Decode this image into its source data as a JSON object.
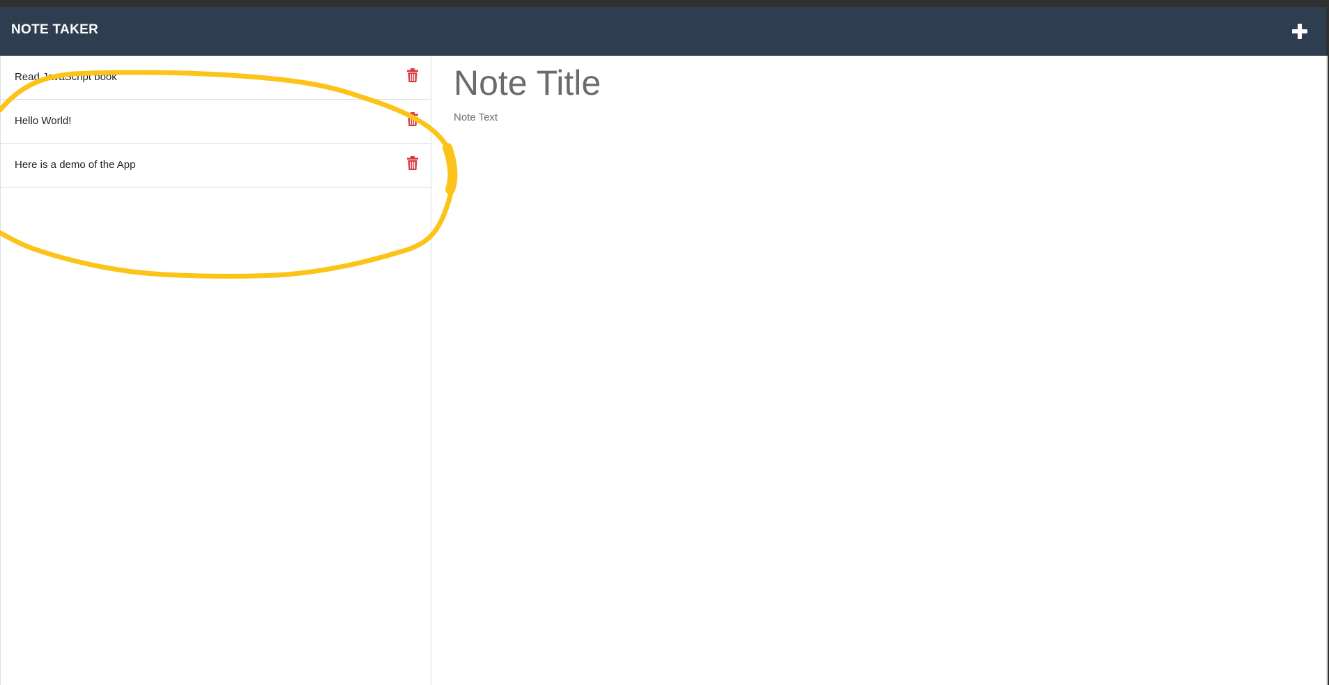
{
  "app": {
    "brand": "NOTE TAKER",
    "new_note_icon": "plus-icon"
  },
  "notes": [
    {
      "title": "Read JavaScript book",
      "delete_icon": "trash-icon"
    },
    {
      "title": "Hello World!",
      "delete_icon": "trash-icon"
    },
    {
      "title": "Here is a demo of the App",
      "delete_icon": "trash-icon"
    }
  ],
  "editor": {
    "title_placeholder": "Note Title",
    "text_placeholder": "Note Text"
  },
  "colors": {
    "navbar": "#2e3e50",
    "trash": "#d9363e",
    "annotation_highlight": "#fcc419"
  }
}
